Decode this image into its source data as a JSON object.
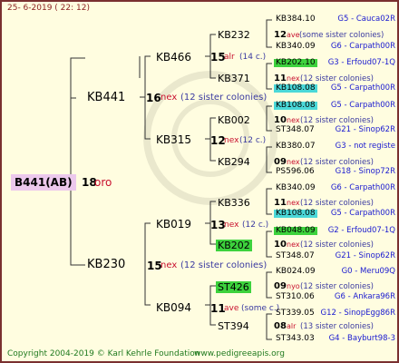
{
  "header": "25-  6-2019  ( 22: 12)",
  "footer": {
    "copyright": "Copyright 2004-2019 © Karl Kehrle Foundation",
    "url": "www.pedigreeapis.org"
  },
  "root": {
    "id": "B441(AB)",
    "number": "18",
    "origin": "oro"
  },
  "gen1": [
    {
      "id": "KB441",
      "number": "16",
      "origin": "nex",
      "note": "(12 sister colonies)"
    },
    {
      "id": "KB230",
      "number": "15",
      "origin": "nex",
      "note": "(12 sister colonies)"
    }
  ],
  "gen2": [
    {
      "id": "KB466",
      "number": "15",
      "origin": "alr",
      "note": "(14 c.)"
    },
    {
      "id": "KB315",
      "number": "12",
      "origin": "nex",
      "note": "(12 c.)"
    },
    {
      "id": "KB019",
      "number": "13",
      "origin": "nex",
      "note": "(12 c.)"
    },
    {
      "id": "KB094",
      "number": "11",
      "origin": "ave",
      "note": "(some c.)"
    }
  ],
  "gen3": [
    {
      "id": "KB232",
      "number": "12",
      "origin": "ave",
      "note": "(some sister colonies)"
    },
    {
      "id": "KB371",
      "number": "11",
      "origin": "nex",
      "note": "(12 sister colonies)"
    },
    {
      "id": "KB002",
      "number": "10",
      "origin": "nex",
      "note": "(12 sister colonies)"
    },
    {
      "id": "KB294",
      "number": "09",
      "origin": "nex",
      "note": "(12 sister colonies)"
    },
    {
      "id": "KB336",
      "number": "11",
      "origin": "nex",
      "note": "(12 sister colonies)"
    },
    {
      "id": "KB202",
      "number": "10",
      "origin": "nex",
      "note": "(12 sister colonies)"
    },
    {
      "id": "ST426",
      "number": "09",
      "origin": "nyo",
      "note": "(12 sister colonies)"
    },
    {
      "id": "ST394",
      "number": "08",
      "origin": "alr",
      "note": "(13 sister colonies)"
    }
  ],
  "gen4": [
    {
      "id": "KB384.10",
      "loc": "G5 - Cauca02R"
    },
    {
      "id": "KB340.09",
      "loc": "G6 - Carpath00R"
    },
    {
      "id": "KB202.10",
      "loc": "G3 - Erfoud07-1Q"
    },
    {
      "id": "KB108.08",
      "loc": "G5 - Carpath00R"
    },
    {
      "id": "KB108.08",
      "loc": "G5 - Carpath00R"
    },
    {
      "id": "ST348.07",
      "loc": "G21 - Sinop62R"
    },
    {
      "id": "KB380.07",
      "loc": "G3 - not registe"
    },
    {
      "id": "PS596.06",
      "loc": "G18 - Sinop72R"
    },
    {
      "id": "KB340.09",
      "loc": "G6 - Carpath00R"
    },
    {
      "id": "KB108.08",
      "loc": "G5 - Carpath00R"
    },
    {
      "id": "KB048.09",
      "loc": "G2 - Erfoud07-1Q"
    },
    {
      "id": "ST348.07",
      "loc": "G21 - Sinop62R"
    },
    {
      "id": "KB024.09",
      "loc": "G0 - Meru09Q"
    },
    {
      "id": "ST310.06",
      "loc": "G6 - Ankara96R"
    },
    {
      "id": "ST339.05",
      "loc": "G12 - SinopEgg86R"
    },
    {
      "id": "ST343.03",
      "loc": "G4 - Bayburt98-3"
    }
  ],
  "colors": {
    "border": "#7a3030",
    "background": "#fffde0",
    "origin": "#c8102e",
    "note": "#3a3aa0",
    "loc": "#1a1ad0",
    "highlight_green": "#3dd23d",
    "highlight_cyan": "#4ad8d8"
  }
}
